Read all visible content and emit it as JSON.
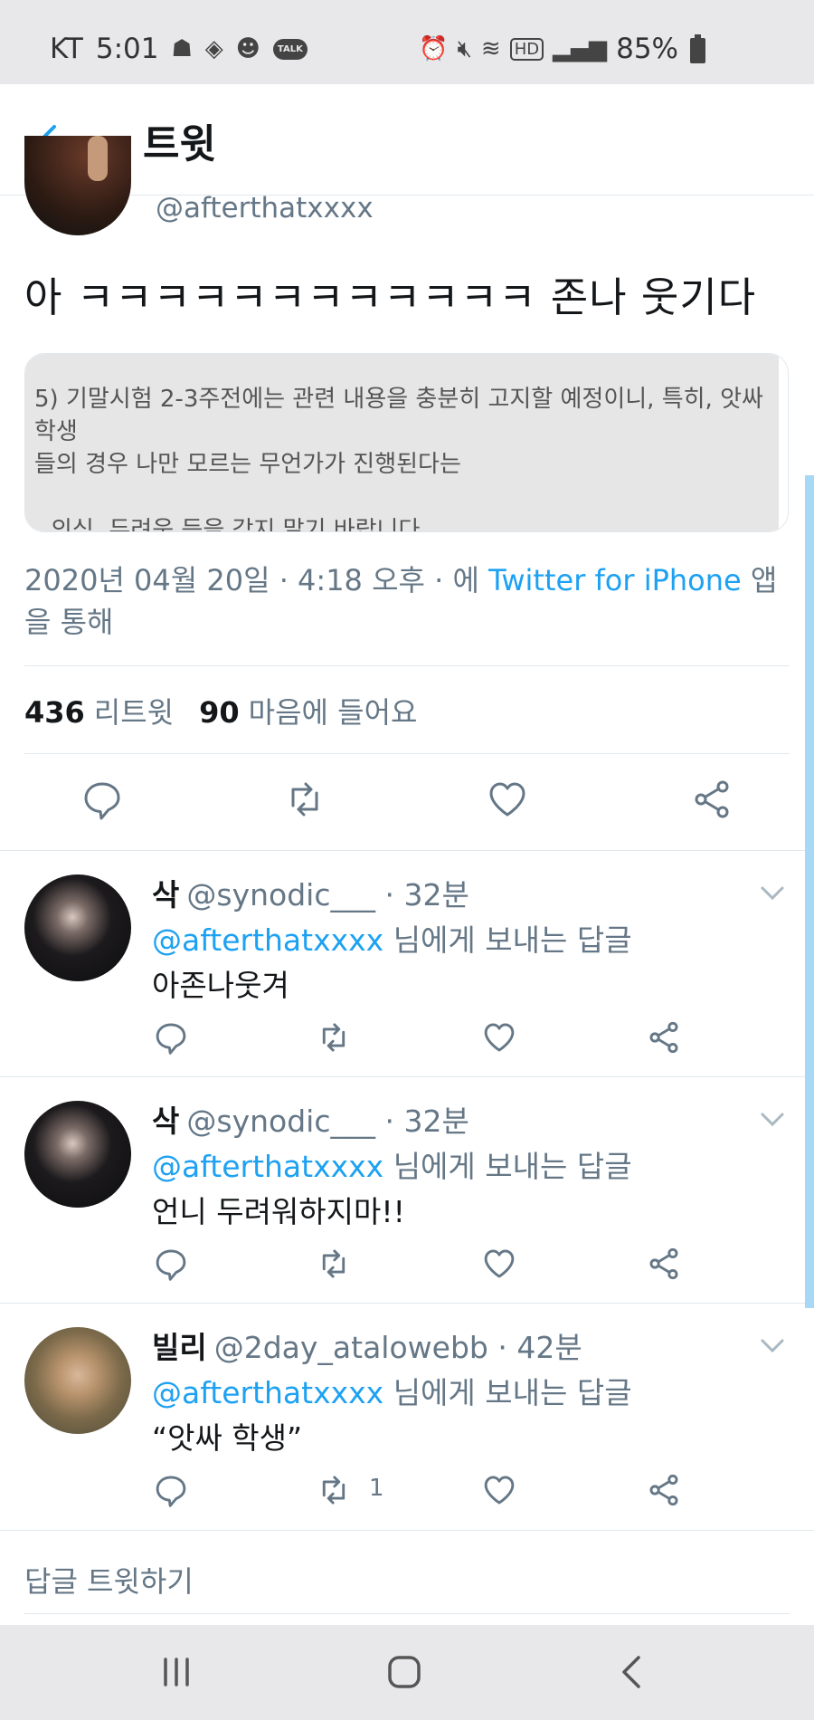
{
  "status_bar": {
    "carrier": "KT",
    "time": "5:01",
    "hd": "HD",
    "talk_badge": "TALK",
    "battery": "85%"
  },
  "header": {
    "title": "트윗"
  },
  "tweet": {
    "handle": "@afterthatxxxx",
    "text": "아 ㅋㅋㅋㅋㅋㅋㅋㅋㅋㅋㅋㅋ 존나 웃기다",
    "quote_line_1": "5) 기말시험 2-3주전에는 관련 내용을 충분히 고지할 예정이니, 특히, 앗싸 학생",
    "quote_line_2": "들의 경우 나만 모르는 무언가가 진행된다는",
    "quote_line_3": "의심, 두려움 등을 갖지 말기 바랍니다.",
    "meta_prefix": "2020년 04월 20일 · 4:18 오후 · 에 ",
    "meta_source": "Twitter for iPhone",
    "meta_suffix": " 앱을 통해",
    "retweets_count": "436",
    "retweets_label": "리트윗",
    "likes_count": "90",
    "likes_label": "마음에 들어요"
  },
  "replies": [
    {
      "name": "삭",
      "handle": "@synodic___",
      "time": "· 32분",
      "mention": "@afterthatxxxx",
      "reply_label": " 님에게 보내는 답글",
      "text": "아존나웃겨",
      "retweet_count": ""
    },
    {
      "name": "삭",
      "handle": "@synodic___",
      "time": "· 32분",
      "mention": "@afterthatxxxx",
      "reply_label": " 님에게 보내는 답글",
      "text": "언니 두려워하지마!!",
      "retweet_count": ""
    },
    {
      "name": "빌리",
      "handle": "@2day_atalowebb",
      "time": "· 42분",
      "mention": "@afterthatxxxx",
      "reply_label": " 님에게 보내는 답글",
      "text": "“앗싸 학생”",
      "retweet_count": "1"
    }
  ],
  "compose": {
    "placeholder": "답글 트윗하기"
  },
  "colors": {
    "accent": "#1da1f2",
    "secondary_text": "#657786",
    "divider": "#e1e8ed"
  }
}
